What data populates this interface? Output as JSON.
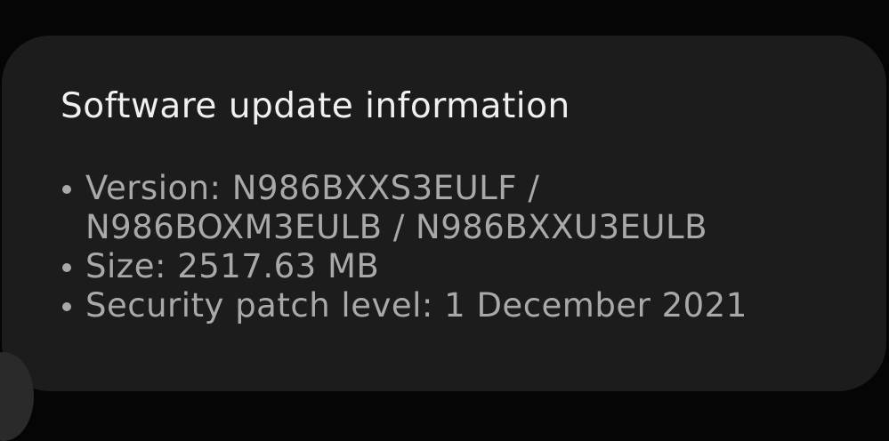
{
  "card": {
    "title": "Software update information",
    "items": [
      {
        "label": "Version:",
        "value_line1": "N986BXXS3EULF /",
        "value_line2": "N986BOXM3EULB / N986BXXU3EULB"
      },
      {
        "label": "Size:",
        "value": "2517.63 MB"
      },
      {
        "label": "Security patch level:",
        "value": "1 December 2021"
      }
    ]
  },
  "colors": {
    "background": "#050505",
    "card": "#1c1c1c",
    "title_text": "#f0f0f0",
    "body_text": "#a9a9a9"
  }
}
